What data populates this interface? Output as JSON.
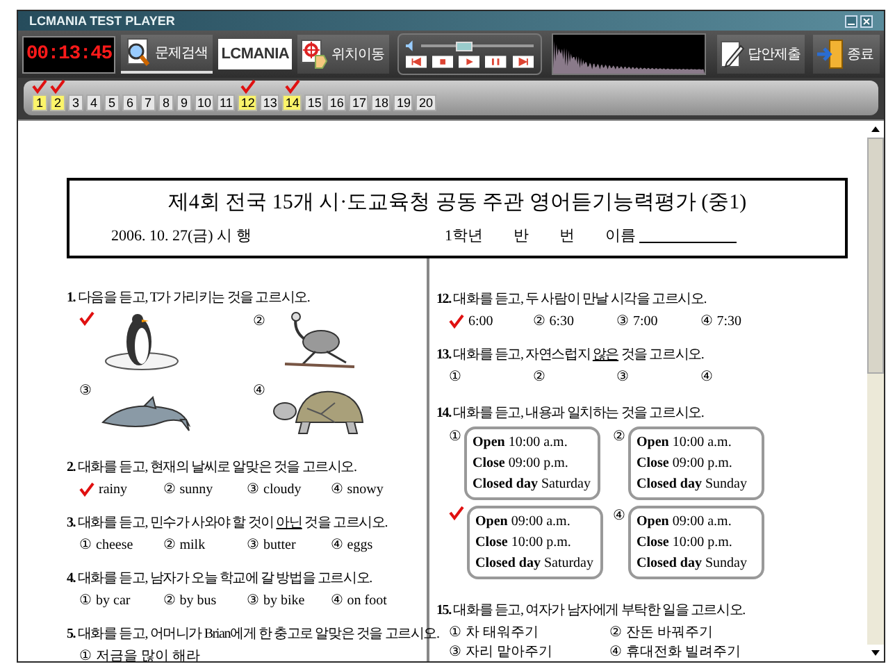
{
  "window": {
    "title": "LCMANIA TEST PLAYER"
  },
  "toolbar": {
    "timer": "00:13:45",
    "search_button": "문제검색",
    "logo": "LCMANIA",
    "move_button": "위치이동",
    "volume": {
      "level": 0.35
    },
    "submit_button": "답안제출",
    "exit_button": "종료"
  },
  "question_nav": [
    {
      "number": "1",
      "answered": true
    },
    {
      "number": "2",
      "answered": true
    },
    {
      "number": "3",
      "answered": false
    },
    {
      "number": "4",
      "answered": false
    },
    {
      "number": "5",
      "answered": false
    },
    {
      "number": "6",
      "answered": false
    },
    {
      "number": "7",
      "answered": false
    },
    {
      "number": "8",
      "answered": false
    },
    {
      "number": "9",
      "answered": false
    },
    {
      "number": "10",
      "answered": false
    },
    {
      "number": "11",
      "answered": false
    },
    {
      "number": "12",
      "answered": true
    },
    {
      "number": "13",
      "answered": false
    },
    {
      "number": "14",
      "answered": true
    },
    {
      "number": "15",
      "answered": false
    },
    {
      "number": "16",
      "answered": false
    },
    {
      "number": "17",
      "answered": false
    },
    {
      "number": "18",
      "answered": false
    },
    {
      "number": "19",
      "answered": false
    },
    {
      "number": "20",
      "answered": false
    }
  ],
  "exam": {
    "title": "제4회 전국 15개 시·도교육청 공동 주관 영어듣기능력평가 (중1)",
    "date": "2006. 10. 27(금) 시 행",
    "class_fields": [
      "1학년",
      "반",
      "번",
      "이름"
    ]
  },
  "left_column": [
    {
      "number": "1.",
      "kind": "pictures",
      "prompt": [
        {
          "text": "다음을 듣고, T가 가리키는 것을 고르시오.",
          "underlined": false
        }
      ],
      "choices": [
        {
          "selected": true
        },
        {
          "mark": "②",
          "selected": false
        },
        {
          "mark": "③",
          "selected": false
        },
        {
          "mark": "④",
          "selected": false
        }
      ]
    },
    {
      "number": "2.",
      "kind": "choices",
      "prompt": [
        {
          "text": "대화를 듣고, 현재의 날씨로 알맞은 것을 고르시오.",
          "underlined": false
        }
      ],
      "choices": [
        {
          "text": "rainy",
          "selected": true
        },
        {
          "mark": "②",
          "text": "sunny",
          "selected": false
        },
        {
          "mark": "③",
          "text": "cloudy",
          "selected": false
        },
        {
          "mark": "④",
          "text": "snowy",
          "selected": false
        }
      ]
    },
    {
      "number": "3.",
      "kind": "choices",
      "prompt": [
        {
          "text": "대화를 듣고, 민수가 사와야 할 것이 ",
          "underlined": false
        },
        {
          "text": "아닌",
          "underlined": true
        },
        {
          "text": " 것을 고르시오.",
          "underlined": false
        }
      ],
      "choices": [
        {
          "mark": "①",
          "text": "cheese",
          "selected": false
        },
        {
          "mark": "②",
          "text": "milk",
          "selected": false
        },
        {
          "mark": "③",
          "text": "butter",
          "selected": false
        },
        {
          "mark": "④",
          "text": "eggs",
          "selected": false
        }
      ]
    },
    {
      "number": "4.",
      "kind": "choices",
      "prompt": [
        {
          "text": "대화를 듣고, 남자가 오늘 학교에 갈 방법을 고르시오.",
          "underlined": false
        }
      ],
      "choices": [
        {
          "mark": "①",
          "text": "by car",
          "selected": false
        },
        {
          "mark": "②",
          "text": "by bus",
          "selected": false
        },
        {
          "mark": "③",
          "text": "by bike",
          "selected": false
        },
        {
          "mark": "④",
          "text": "on foot",
          "selected": false
        }
      ]
    },
    {
      "number": "5.",
      "kind": "choices",
      "prompt": [
        {
          "text": "대화를 듣고, 어머니가 Brian에게 한 충고로 알맞은 것을 고르시오.",
          "underlined": false
        }
      ],
      "choices": [
        {
          "mark": "①",
          "text": "저금을 많이 해라",
          "selected": false
        }
      ]
    }
  ],
  "right_column": [
    {
      "number": "12.",
      "kind": "choices",
      "prompt": [
        {
          "text": "대화를 듣고, 두 사람이 만날 시각을 고르시오.",
          "underlined": false
        }
      ],
      "choices": [
        {
          "text": "6:00",
          "selected": true
        },
        {
          "mark": "②",
          "text": "6:30",
          "selected": false
        },
        {
          "mark": "③",
          "text": "7:00",
          "selected": false
        },
        {
          "mark": "④",
          "text": "7:30",
          "selected": false
        }
      ]
    },
    {
      "number": "13.",
      "kind": "choices",
      "prompt": [
        {
          "text": "대화를 듣고, 자연스럽지 ",
          "underlined": false
        },
        {
          "text": "않은",
          "underlined": true
        },
        {
          "text": " 것을 고르시오.",
          "underlined": false
        }
      ],
      "choices": [
        {
          "mark": "①",
          "selected": false
        },
        {
          "mark": "②",
          "selected": false
        },
        {
          "mark": "③",
          "selected": false
        },
        {
          "mark": "④",
          "selected": false
        }
      ]
    },
    {
      "number": "14.",
      "kind": "cards",
      "prompt": [
        {
          "text": "대화를 듣고, 내용과 일치하는 것을 고르시오.",
          "underlined": false
        }
      ],
      "choices": [
        {
          "mark": "①",
          "selected": false,
          "lines": [
            "**Open** 10:00 a.m.",
            "**Close** 09:00 p.m.",
            "**Closed day** Saturday"
          ]
        },
        {
          "mark": "②",
          "selected": false,
          "lines": [
            "**Open** 10:00 a.m.",
            "**Close** 09:00 p.m.",
            "**Closed day** Sunday"
          ]
        },
        {
          "selected": true,
          "lines": [
            "**Open** 09:00 a.m.",
            "**Close** 10:00 p.m.",
            "**Closed day** Saturday"
          ]
        },
        {
          "mark": "④",
          "selected": false,
          "lines": [
            "**Open** 09:00 a.m.",
            "**Close** 10:00 p.m.",
            "**Closed day** Sunday"
          ]
        }
      ]
    },
    {
      "number": "15.",
      "kind": "two_columns",
      "prompt": [
        {
          "text": "대화를 듣고, 여자가 남자에게 부탁한 일을 고르시오.",
          "underlined": false
        }
      ],
      "choices": [
        {
          "mark": "①",
          "text": "차 태워주기",
          "selected": false
        },
        {
          "mark": "②",
          "text": "잔돈 바꿔주기",
          "selected": false
        },
        {
          "mark": "③",
          "text": "자리 맡아주기",
          "selected": false
        },
        {
          "mark": "④",
          "text": "휴대전화 빌려주기",
          "selected": false
        }
      ]
    }
  ]
}
